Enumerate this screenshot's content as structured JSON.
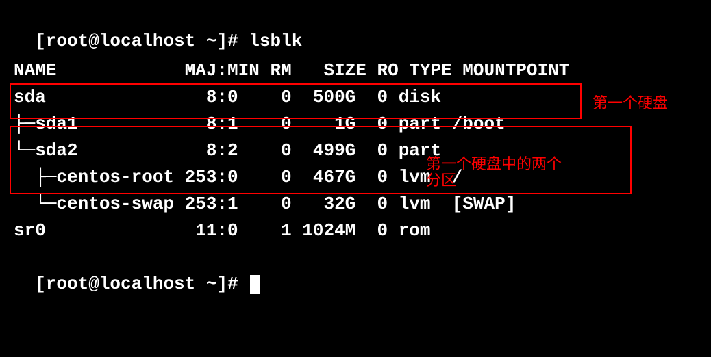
{
  "prompt1": "[root@localhost ~]# ",
  "command1": "lsblk",
  "header": "NAME            MAJ:MIN RM   SIZE RO TYPE MOUNTPOINT",
  "row_sda": "sda               8:0    0  500G  0 disk ",
  "row_sda1": "├─sda1            8:1    0    1G  0 part /boot",
  "row_sda2": "└─sda2            8:2    0  499G  0 part ",
  "row_centos_root": "  ├─centos-root 253:0    0  467G  0 lvm  /",
  "row_centos_swap": "  └─centos-swap 253:1    0   32G  0 lvm  [SWAP]",
  "row_sr0": "sr0              11:0    1 1024M  0 rom  ",
  "prompt2": "[root@localhost ~]# ",
  "annotation1": "第一个硬盘",
  "annotation2": "第一个硬盘中的两个分区",
  "chart_data": {
    "type": "table",
    "columns": [
      "NAME",
      "MAJ:MIN",
      "RM",
      "SIZE",
      "RO",
      "TYPE",
      "MOUNTPOINT"
    ],
    "rows": [
      {
        "NAME": "sda",
        "MAJ:MIN": "8:0",
        "RM": 0,
        "SIZE": "500G",
        "RO": 0,
        "TYPE": "disk",
        "MOUNTPOINT": ""
      },
      {
        "NAME": "sda1",
        "MAJ:MIN": "8:1",
        "RM": 0,
        "SIZE": "1G",
        "RO": 0,
        "TYPE": "part",
        "MOUNTPOINT": "/boot",
        "parent": "sda"
      },
      {
        "NAME": "sda2",
        "MAJ:MIN": "8:2",
        "RM": 0,
        "SIZE": "499G",
        "RO": 0,
        "TYPE": "part",
        "MOUNTPOINT": "",
        "parent": "sda"
      },
      {
        "NAME": "centos-root",
        "MAJ:MIN": "253:0",
        "RM": 0,
        "SIZE": "467G",
        "RO": 0,
        "TYPE": "lvm",
        "MOUNTPOINT": "/",
        "parent": "sda2"
      },
      {
        "NAME": "centos-swap",
        "MAJ:MIN": "253:1",
        "RM": 0,
        "SIZE": "32G",
        "RO": 0,
        "TYPE": "lvm",
        "MOUNTPOINT": "[SWAP]",
        "parent": "sda2"
      },
      {
        "NAME": "sr0",
        "MAJ:MIN": "11:0",
        "RM": 1,
        "SIZE": "1024M",
        "RO": 0,
        "TYPE": "rom",
        "MOUNTPOINT": ""
      }
    ]
  }
}
